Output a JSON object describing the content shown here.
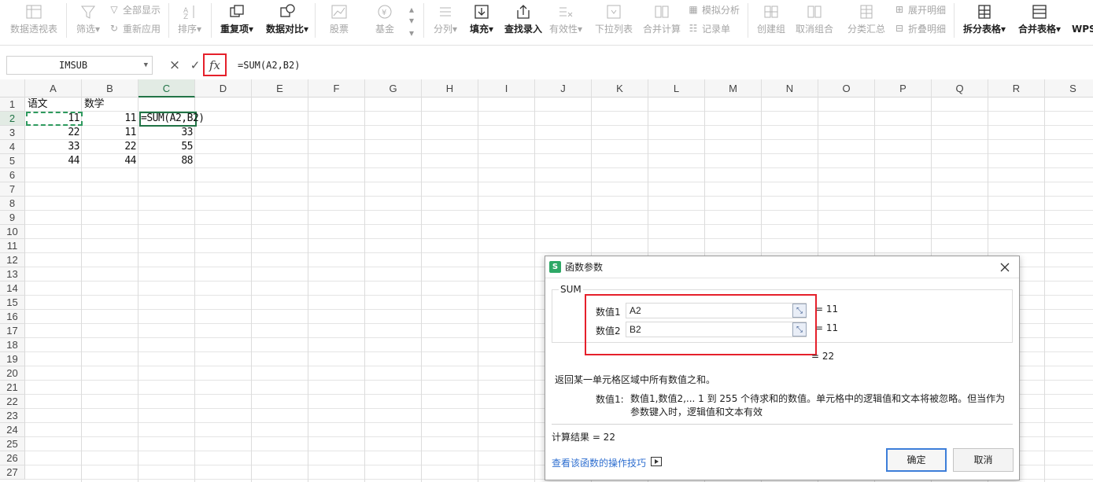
{
  "ribbon": {
    "pivot": "数据透视表",
    "filter": "筛选",
    "show_all": "全部显示",
    "reapply": "重新应用",
    "sort": "排序",
    "duplicates": "重复项",
    "compare": "数据对比",
    "stock": "股票",
    "fund": "基金",
    "split_col": "分列",
    "fill": "填充",
    "lookup": "查找录入",
    "validity": "有效性",
    "dropdown": "下拉列表",
    "consolidate": "合并计算",
    "whatif": "模拟分析",
    "record": "记录单",
    "group": "创建组",
    "ungroup": "取消组合",
    "subtotal": "分类汇总",
    "expand": "展开明细",
    "collapse": "折叠明细",
    "split_table": "拆分表格",
    "merge_table": "合并表格",
    "wps": "WPS"
  },
  "formula_bar": {
    "name_box": "IMSUB",
    "cancel_icon": "×",
    "confirm_icon": "✓",
    "fx_label": "fx",
    "content": "=SUM(A2,B2)"
  },
  "columns": [
    "A",
    "B",
    "C",
    "D",
    "E",
    "F",
    "G",
    "H",
    "I",
    "J",
    "K",
    "L",
    "M",
    "N",
    "O",
    "P",
    "Q",
    "R",
    "S"
  ],
  "rows": [
    "1",
    "2",
    "3",
    "4",
    "5",
    "6",
    "7",
    "8",
    "9",
    "10",
    "11",
    "12",
    "13",
    "14",
    "15",
    "16",
    "17",
    "18",
    "19",
    "20",
    "21",
    "22",
    "23",
    "24",
    "25",
    "26",
    "27"
  ],
  "cells": {
    "A1": "语文",
    "B1": "数学",
    "A2": "11",
    "B2": "11",
    "C2": "=SUM(A2,B2)",
    "A3": "22",
    "B3": "11",
    "C3": "33",
    "A4": "33",
    "B4": "22",
    "C4": "55",
    "A5": "44",
    "B5": "44",
    "C5": "88"
  },
  "dialog": {
    "title": "函数参数",
    "function_name": "SUM",
    "args": [
      {
        "label": "数值1",
        "value": "A2",
        "result": "= 11"
      },
      {
        "label": "数值2",
        "value": "B2",
        "result": "= 11"
      }
    ],
    "total": "= 22",
    "description": "返回某一单元格区域中所有数值之和。",
    "arg_desc_label": "数值1:",
    "arg_desc_text": "数值1,数值2,... 1 到 255 个待求和的数值。单元格中的逻辑值和文本将被忽略。但当作为参数键入时，逻辑值和文本有效",
    "calc_result": "计算结果  =  22",
    "help_link": "查看该函数的操作技巧",
    "ok": "确定",
    "cancel": "取消"
  },
  "colors": {
    "accent": "#217346",
    "highlight": "#e5202b",
    "link": "#2f6fd0"
  }
}
